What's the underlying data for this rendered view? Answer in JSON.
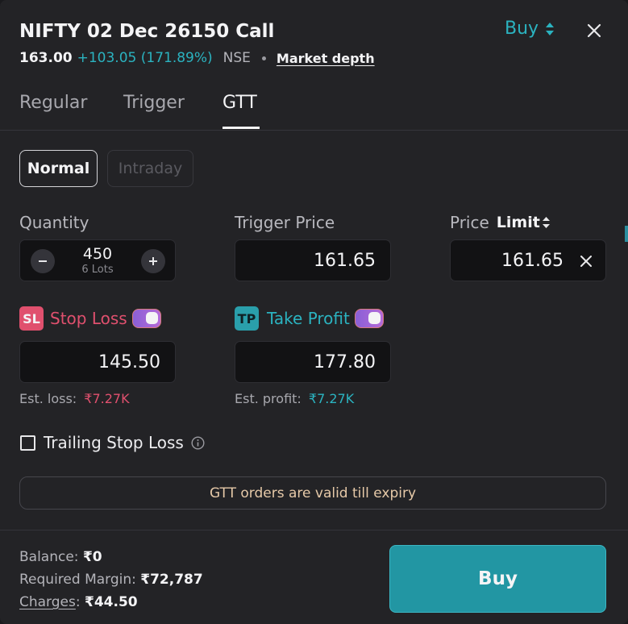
{
  "header": {
    "title": "NIFTY 02 Dec 26150 Call",
    "ltp": "163.00",
    "change": "+103.05 (171.89%)",
    "exchange": "NSE",
    "market_depth": "Market depth",
    "side_label": "Buy"
  },
  "tabs": [
    {
      "label": "Regular",
      "active": false
    },
    {
      "label": "Trigger",
      "active": false
    },
    {
      "label": "GTT",
      "active": true
    }
  ],
  "product": {
    "normal": "Normal",
    "intraday": "Intraday"
  },
  "quantity": {
    "label": "Quantity",
    "value": "450",
    "lots": "6 Lots"
  },
  "trigger_price": {
    "label": "Trigger Price",
    "value": "161.65"
  },
  "price": {
    "label": "Price",
    "type": "Limit",
    "value": "161.65"
  },
  "stop_loss": {
    "badge": "SL",
    "label": "Stop Loss",
    "enabled": true,
    "value": "145.50",
    "est_label": "Est. loss:",
    "est_value": "₹7.27K"
  },
  "take_profit": {
    "badge": "TP",
    "label": "Take Profit",
    "enabled": true,
    "value": "177.80",
    "est_label": "Est. profit:",
    "est_value": "₹7.27K"
  },
  "trailing": {
    "label": "Trailing Stop Loss",
    "checked": false
  },
  "banner": "GTT orders are valid till expiry",
  "footer": {
    "balance_label": "Balance:",
    "balance_value": "₹0",
    "margin_label": "Required Margin:",
    "margin_value": "₹72,787",
    "charges_label": "Charges",
    "charges_sep": ":",
    "charges_value": "₹44.50",
    "buy_button": "Buy"
  },
  "colors": {
    "accent": "#2bb3c0",
    "loss": "#e0506e",
    "buy_button": "#2296a3",
    "panel": "#232326"
  }
}
